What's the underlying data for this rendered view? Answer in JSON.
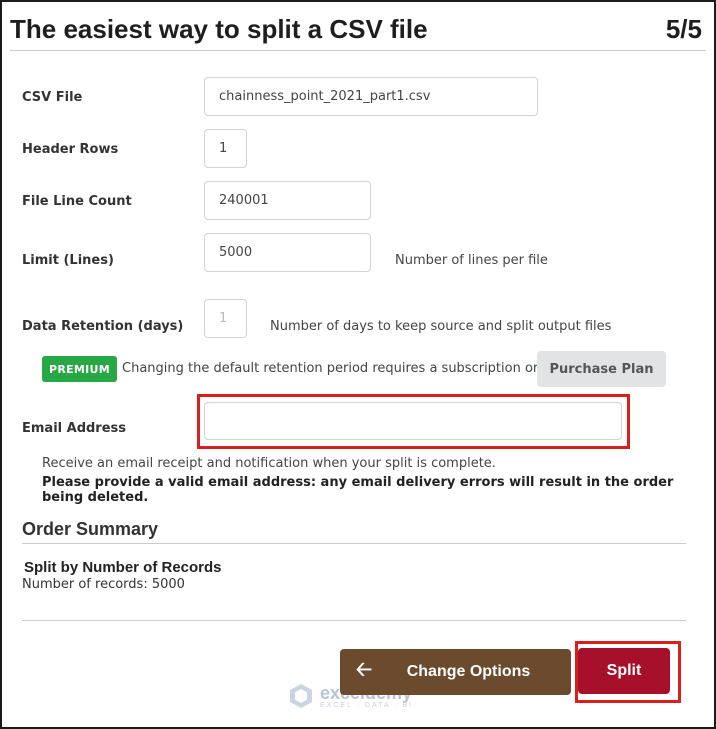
{
  "header": {
    "title": "The easiest way to split a CSV file",
    "step": "5/5"
  },
  "form": {
    "csv_file": {
      "label": "CSV File",
      "value": "chainness_point_2021_part1.csv"
    },
    "header_rows": {
      "label": "Header Rows",
      "value": "1"
    },
    "file_line_count": {
      "label": "File Line Count",
      "value": "240001"
    },
    "limit": {
      "label": "Limit (Lines)",
      "value": "5000",
      "hint": "Number of lines per file"
    },
    "retention": {
      "label": "Data Retention (days)",
      "value": "1",
      "hint": "Number of days to keep source and split output files"
    },
    "premium": {
      "badge": "PREMIUM",
      "text": "Changing the default retention period requires a subscription or plan",
      "button": "Purchase Plan"
    },
    "email": {
      "label": "Email Address",
      "value": "",
      "note": "Receive an email receipt and notification when your split is complete.",
      "warning": "Please provide a valid email address: any email delivery errors will result in the order being deleted."
    }
  },
  "summary": {
    "title": "Order Summary",
    "heading": "Split by Number of Records",
    "detail": "Number of records: 5000"
  },
  "actions": {
    "change_options": "Change Options",
    "split": "Split"
  },
  "watermark": {
    "name": "exceldemy",
    "tagline": "EXCEL · DATA · BI"
  },
  "colors": {
    "premium_badge": "#28a745",
    "change_button": "#6b4a2e",
    "split_button": "#a6102a",
    "highlight": "#d91e1e"
  }
}
